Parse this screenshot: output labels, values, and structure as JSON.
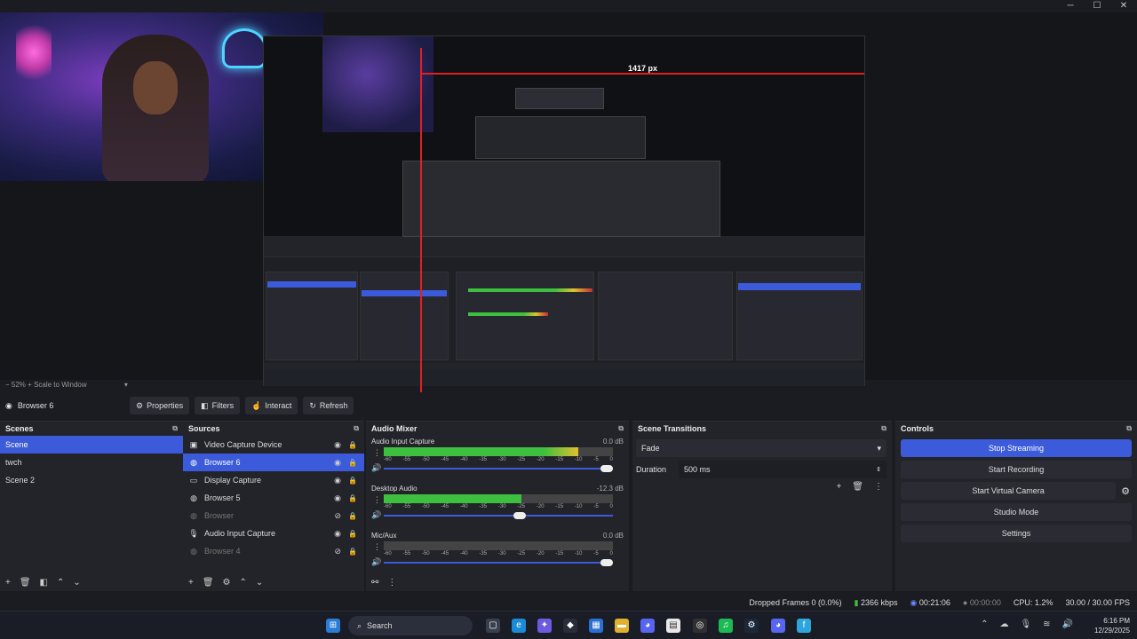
{
  "window_controls": [
    "─",
    "☐",
    "✕"
  ],
  "preview": {
    "measure_label": "1417 px",
    "zoom_text": "52%",
    "scale_mode": "Scale to Window"
  },
  "toolbar": {
    "source_name": "Browser 6",
    "properties": "Properties",
    "filters": "Filters",
    "interact": "Interact",
    "refresh": "Refresh"
  },
  "scenes": {
    "title": "Scenes",
    "items": [
      {
        "label": "Scene",
        "selected": true
      },
      {
        "label": "twch",
        "selected": false
      },
      {
        "label": "Scene 2",
        "selected": false
      }
    ]
  },
  "sources": {
    "title": "Sources",
    "items": [
      {
        "label": "Video Capture Device",
        "icon": "camera-icon"
      },
      {
        "label": "Browser 6",
        "icon": "globe-icon",
        "selected": true
      },
      {
        "label": "Display Capture",
        "icon": "monitor-icon"
      },
      {
        "label": "Browser 5",
        "icon": "globe-icon"
      },
      {
        "label": "Browser",
        "icon": "globe-icon",
        "hidden": true
      },
      {
        "label": "Audio Input Capture",
        "icon": "microphone-icon"
      },
      {
        "label": "Browser 4",
        "icon": "globe-icon",
        "hidden": true
      }
    ]
  },
  "mixer": {
    "title": "Audio Mixer",
    "channels": [
      {
        "name": "Audio Input Capture",
        "db": "0.0 dB",
        "level": 0.85,
        "volume": 1.0
      },
      {
        "name": "Desktop Audio",
        "db": "-12.3 dB",
        "level": 0.6,
        "volume": 0.62
      },
      {
        "name": "Mic/Aux",
        "db": "0.0 dB",
        "level": 0.0,
        "volume": 1.0
      }
    ],
    "scale": [
      "-60",
      "-55",
      "-50",
      "-45",
      "-40",
      "-35",
      "-30",
      "-25",
      "-20",
      "-15",
      "-10",
      "-5",
      "0"
    ]
  },
  "transitions": {
    "title": "Scene Transitions",
    "type": "Fade",
    "duration_label": "Duration",
    "duration_value": "500 ms"
  },
  "controls": {
    "title": "Controls",
    "buttons": [
      "Stop Streaming",
      "Start Recording",
      "Start Virtual Camera",
      "Studio Mode",
      "Settings"
    ]
  },
  "status": {
    "dropped": "Dropped Frames 0 (0.0%)",
    "bitrate": "2366 kbps",
    "stream_time": "00:21:06",
    "rec_time": "00:00:00",
    "cpu": "CPU: 1.2%",
    "fps": "30.00 / 30.00 FPS"
  },
  "taskbar": {
    "search": "Search",
    "time": "6:16 PM",
    "date": "12/29/2025"
  },
  "colors": {
    "accent": "#3b5bdb",
    "meter_green": "#3fbf3f",
    "meter_yellow": "#e0c030",
    "meter_red": "#c03030"
  }
}
